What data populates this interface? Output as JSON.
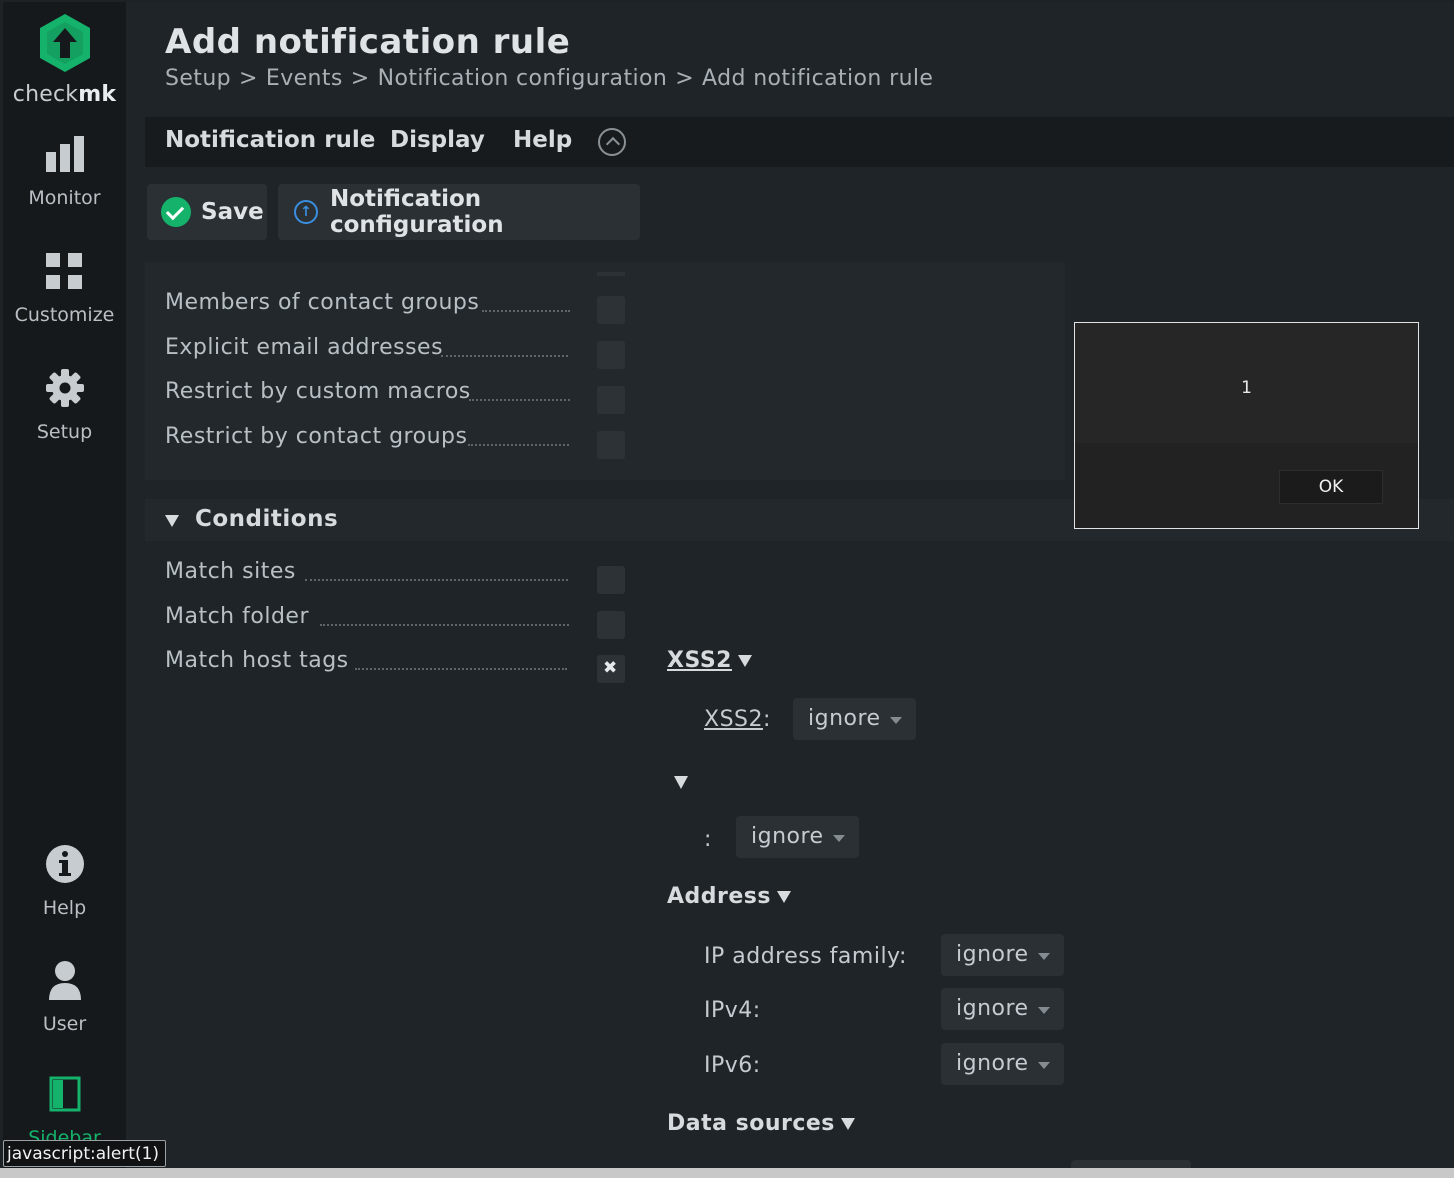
{
  "brand": {
    "logo_text_light": "check",
    "logo_text_bold": "mk",
    "accent": "#15b26b"
  },
  "sidebar": {
    "items": [
      {
        "label": "Monitor",
        "icon": "bar-chart-icon"
      },
      {
        "label": "Customize",
        "icon": "grid-icon"
      },
      {
        "label": "Setup",
        "icon": "gear-icon"
      },
      {
        "label": "Help",
        "icon": "info-icon"
      },
      {
        "label": "User",
        "icon": "user-icon"
      },
      {
        "label": "Sidebar",
        "icon": "sidebar-icon"
      }
    ]
  },
  "header": {
    "title": "Add notification rule",
    "breadcrumb": [
      "Setup",
      "Events",
      "Notification configuration",
      "Add notification rule"
    ],
    "breadcrumb_sep": ">"
  },
  "menubar": {
    "items": [
      "Notification rule",
      "Display",
      "Help"
    ]
  },
  "toolbar": {
    "save_label": "Save",
    "conf_label": "Notification configuration"
  },
  "contact_rows": [
    "Members of contact groups",
    "Explicit email addresses",
    "Restrict by custom macros",
    "Restrict by contact groups"
  ],
  "conditions": {
    "title": "Conditions",
    "rows": [
      "Match sites",
      "Match folder",
      "Match host tags"
    ],
    "host_tags": {
      "group1_title": "XSS2",
      "group1_field_label": "XSS2",
      "group1_field_suffix": ":",
      "group1_value": "ignore",
      "group2_field_label": ":",
      "group2_value": "ignore",
      "address_title": "Address",
      "address_fields": [
        {
          "label": "IP address family:",
          "value": "ignore"
        },
        {
          "label": "IPv4:",
          "value": "ignore"
        },
        {
          "label": "IPv6:",
          "value": "ignore"
        }
      ],
      "data_sources_title": "Data sources"
    }
  },
  "dialog": {
    "message": "1",
    "ok_label": "OK"
  },
  "statusbar": {
    "text": "javascript:alert(1)"
  }
}
